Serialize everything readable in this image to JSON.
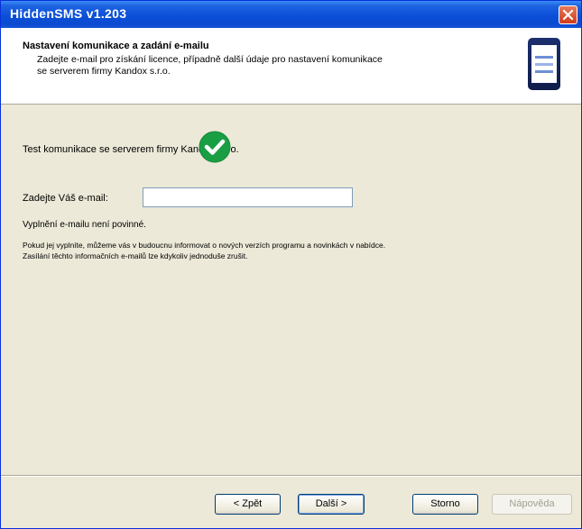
{
  "window": {
    "title": "HiddenSMS v1.203"
  },
  "header": {
    "title": "Nastavení komunikace a zadání e-mailu",
    "subtitle_line1": "Zadejte e-mail pro získání licence, případně další údaje pro nastavení komunikace",
    "subtitle_line2": "se serverem firmy Kandox s.r.o.",
    "icon": "pda-icon"
  },
  "content": {
    "test_label": "Test komunikace se serverem firmy Kandox s.r.o.",
    "test_status_icon": "green-check-icon",
    "email_label": "Zadejte Váš e-mail:",
    "email_value": "",
    "note_optional": "Vyplnění e-mailu není povinné.",
    "note_info_line1": "Pokud jej vyplníte, můžeme vás v budoucnu informovat o nových verzích programu a novinkách v nabídce.",
    "note_info_line2": "Zasílání těchto informačních e-mailů lze kdykoliv jednoduše zrušit."
  },
  "buttons": {
    "back": "< Zpět",
    "next": "Další >",
    "cancel": "Storno",
    "help": "Nápověda"
  },
  "colors": {
    "titlebar": "#0a4fd8",
    "check": "#1a9e44"
  }
}
